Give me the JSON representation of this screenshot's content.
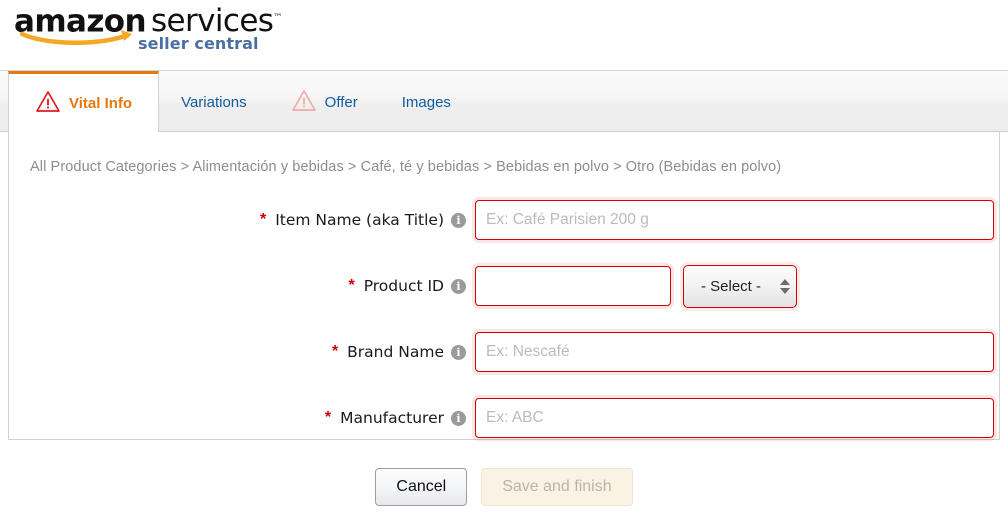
{
  "brand": {
    "logo_line1_bold": "amazon",
    "logo_line1_light": "services",
    "logo_trademark": "™",
    "logo_line2": "seller central",
    "accent_orange": "#e47911",
    "link_blue": "#0f5c9e",
    "error_red": "#d00000",
    "seller_central_blue": "#4a6fa3"
  },
  "tabs": [
    {
      "label": "Vital Info",
      "icon": "warning-triangle-icon",
      "active": true,
      "has_warning": true
    },
    {
      "label": "Variations",
      "icon": "",
      "active": false,
      "has_warning": false
    },
    {
      "label": "Offer",
      "icon": "warning-triangle-icon",
      "active": false,
      "has_warning": true
    },
    {
      "label": "Images",
      "icon": "",
      "active": false,
      "has_warning": false
    }
  ],
  "breadcrumb": {
    "text": "All Product Categories > Alimentación y bebidas > Café, té y bebidas > Bebidas en polvo > Otro (Bebidas en polvo)",
    "items": [
      "All Product Categories",
      "Alimentación y bebidas",
      "Café, té y bebidas",
      "Bebidas en polvo",
      "Otro (Bebidas en polvo)"
    ],
    "separator": ">"
  },
  "form": {
    "required_marker": "*",
    "info_glyph": "i",
    "rows": [
      {
        "label": "Item Name (aka Title)",
        "required": true,
        "value": "",
        "placeholder": "Ex: Café Parisien 200 g"
      },
      {
        "label": "Product ID",
        "required": true,
        "value": "",
        "placeholder": "",
        "select_value": "- Select -"
      },
      {
        "label": "Brand Name",
        "required": true,
        "value": "",
        "placeholder": "Ex: Nescafé"
      },
      {
        "label": "Manufacturer",
        "required": true,
        "value": "",
        "placeholder": "Ex: ABC"
      }
    ]
  },
  "footer": {
    "cancel_label": "Cancel",
    "save_label": "Save and finish",
    "save_disabled": true
  }
}
